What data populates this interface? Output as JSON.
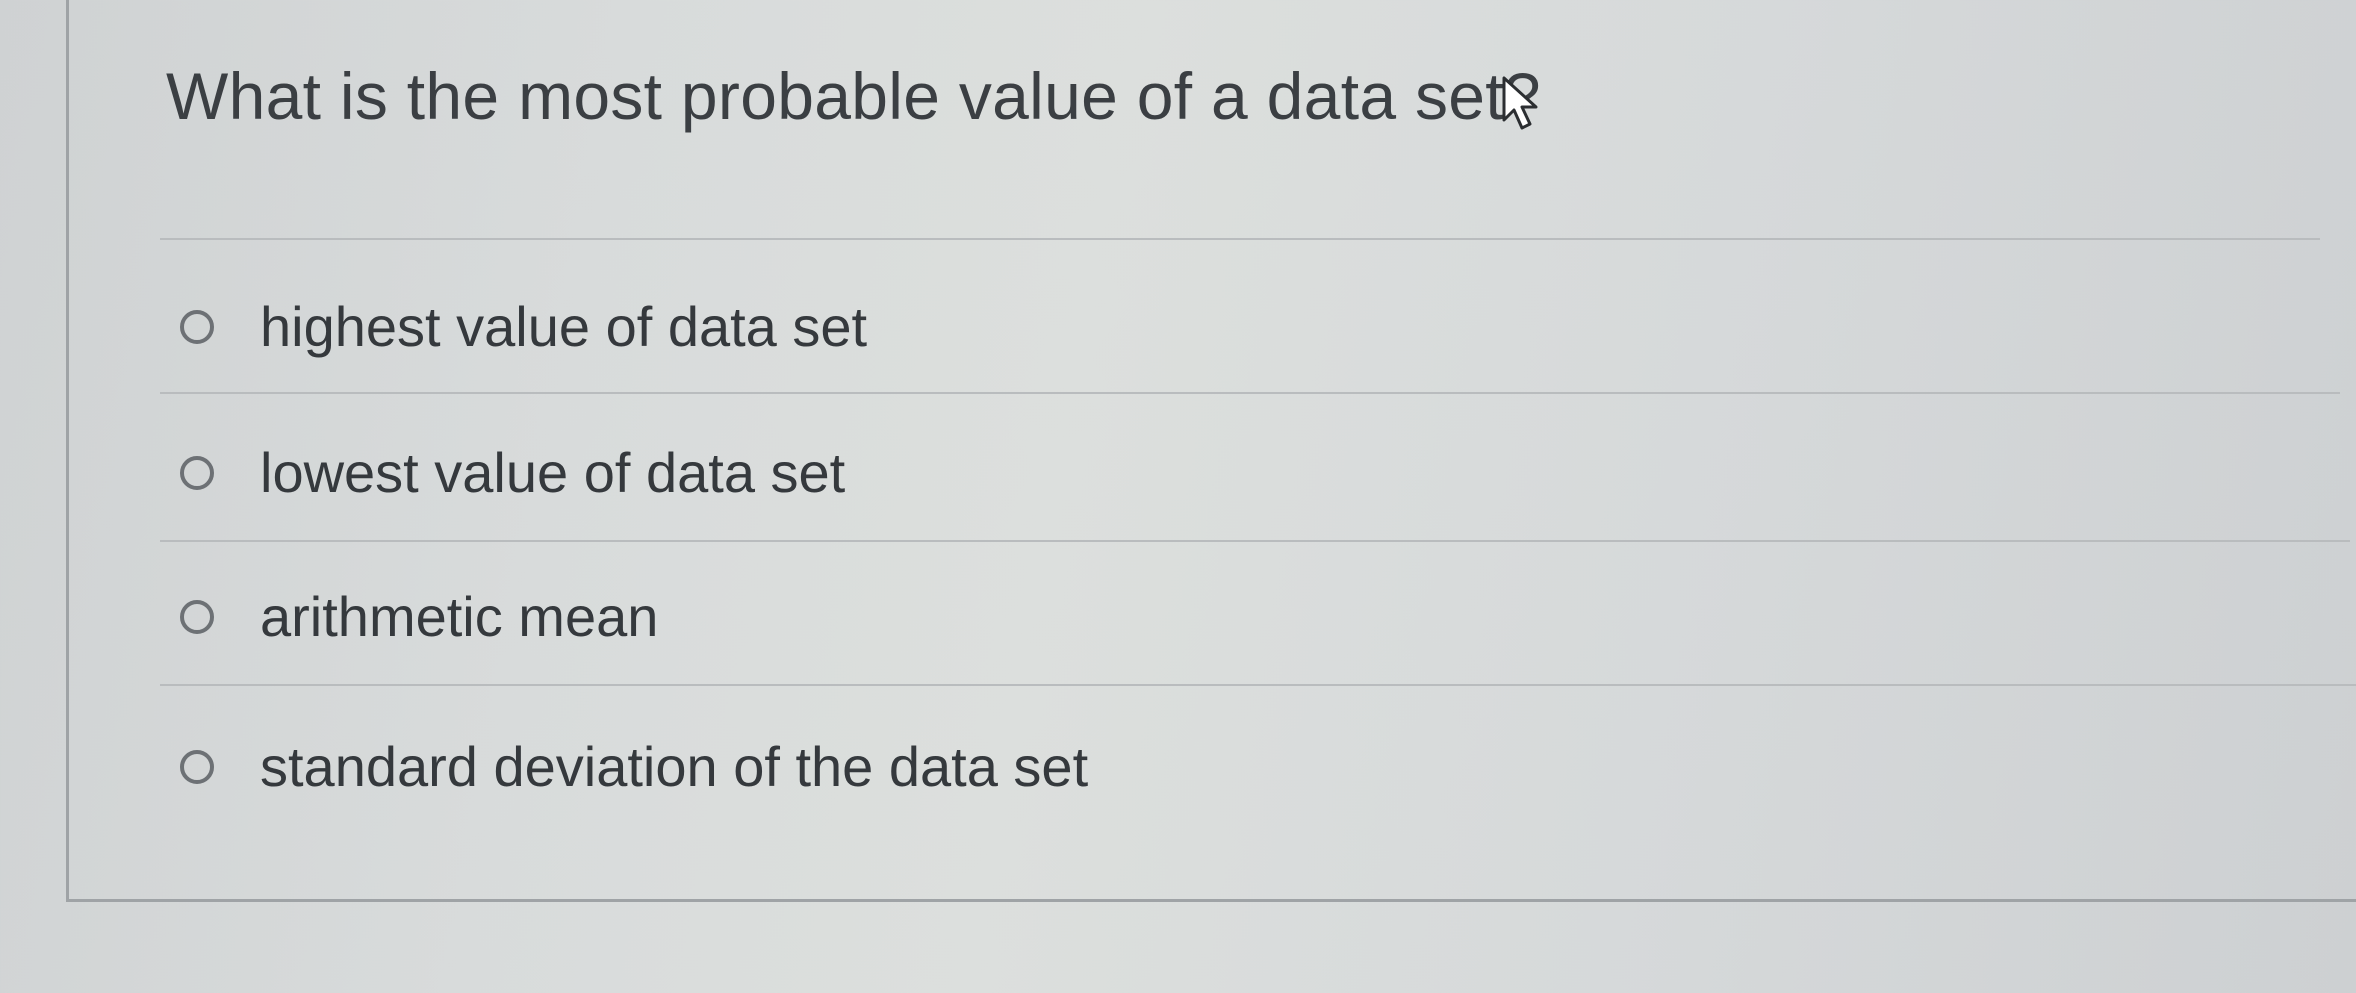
{
  "question": {
    "text": "What is the most probable value of a data set?"
  },
  "options": [
    {
      "label": "highest value of data set",
      "selected": false
    },
    {
      "label": "lowest value of data set",
      "selected": false
    },
    {
      "label": "arithmetic mean",
      "selected": false
    },
    {
      "label": "standard deviation of the data set",
      "selected": false
    }
  ],
  "cursor": {
    "icon": "pointer-arrow-icon"
  },
  "colors": {
    "text": "#35393d",
    "radio_border": "#6d7175",
    "divider": "#b9bcbe",
    "card_border": "#9fa3a6"
  }
}
